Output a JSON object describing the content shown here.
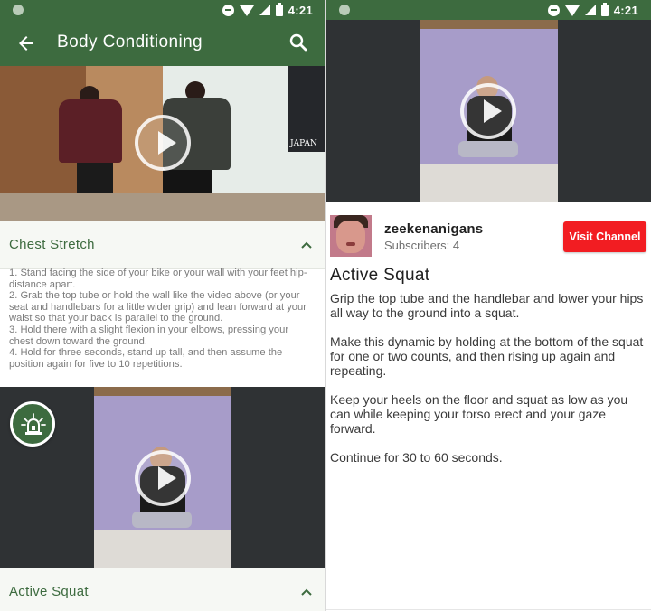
{
  "status_bar": {
    "time": "4:21"
  },
  "left_screen": {
    "app_bar": {
      "title": "Body Conditioning"
    },
    "sections": [
      {
        "title": "Chest Stretch",
        "steps": [
          "1. Stand facing the side of your bike or your wall with your feet hip-distance apart.",
          "2. Grab the top tube or hold the wall like the video above (or your seat and handlebars for a little wider grip) and lean forward at your waist so that your back is parallel to the ground.",
          "3. Hold there with a slight flexion in your elbows, pressing your chest down toward the ground.",
          "4. Hold for three seconds, stand up tall, and then assume the position again for five to 10 repetitions."
        ]
      },
      {
        "title": "Active Squat"
      }
    ],
    "video_overlay": {
      "poster_text": "JAPAN"
    }
  },
  "right_screen": {
    "channel": {
      "name": "zeekenanigans",
      "subscribers": "Subscribers: 4",
      "visit_label": "Visit Channel"
    },
    "video_title": "Active Squat",
    "description": [
      "Grip the top tube and the handlebar and lower your hips all way to the ground into a squat.",
      "Make this dynamic by holding at the bottom of the squat for one or two counts, and then rising up again and repeating.",
      "Keep your heels on the floor and squat as low as you can while keeping your torso erect and your gaze forward.",
      "Continue for 30 to 60 seconds."
    ]
  },
  "colors": {
    "primary": "#3d6b3f",
    "accent_red": "#f21d22",
    "section_title": "#3d6b3f"
  },
  "icons": [
    "back-arrow-icon",
    "search-icon",
    "play-icon",
    "chevron-up-icon",
    "siren-icon",
    "do-not-disturb-icon",
    "wifi-icon",
    "signal-icon",
    "battery-icon"
  ]
}
